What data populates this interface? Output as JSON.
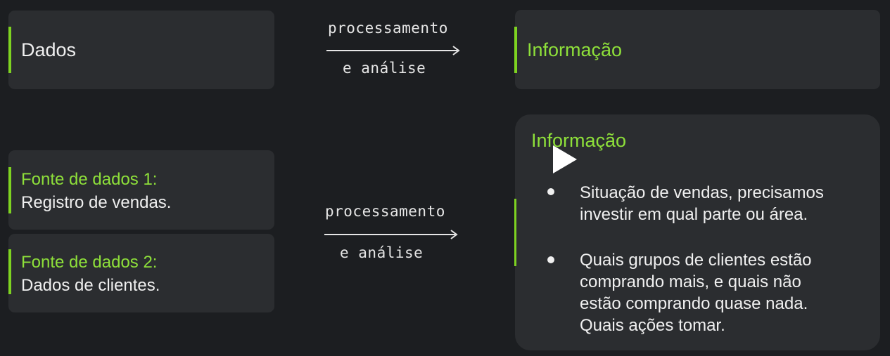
{
  "top": {
    "left_label": "Dados",
    "arrow_top": "processamento",
    "arrow_bottom": "e análise",
    "right_label": "Informação"
  },
  "bottom": {
    "source1": {
      "title": "Fonte de dados 1:",
      "desc": "Registro de vendas."
    },
    "source2": {
      "title": "Fonte de dados 2:",
      "desc": "Dados de clientes."
    },
    "arrow_top": "processamento",
    "arrow_bottom": "e análise",
    "info_title": "Informação",
    "bullets": [
      [
        "Situação de vendas, precisamos",
        "investir em qual parte ou área."
      ],
      [
        "Quais grupos de clientes estão",
        "comprando mais, e quais não",
        "estão comprando quase nada.",
        "Quais ações tomar."
      ]
    ]
  },
  "colors": {
    "accent": "#7ed321",
    "card": "#2b2d30",
    "background": "#1c1e21"
  },
  "icons": {
    "player": "play-icon"
  }
}
